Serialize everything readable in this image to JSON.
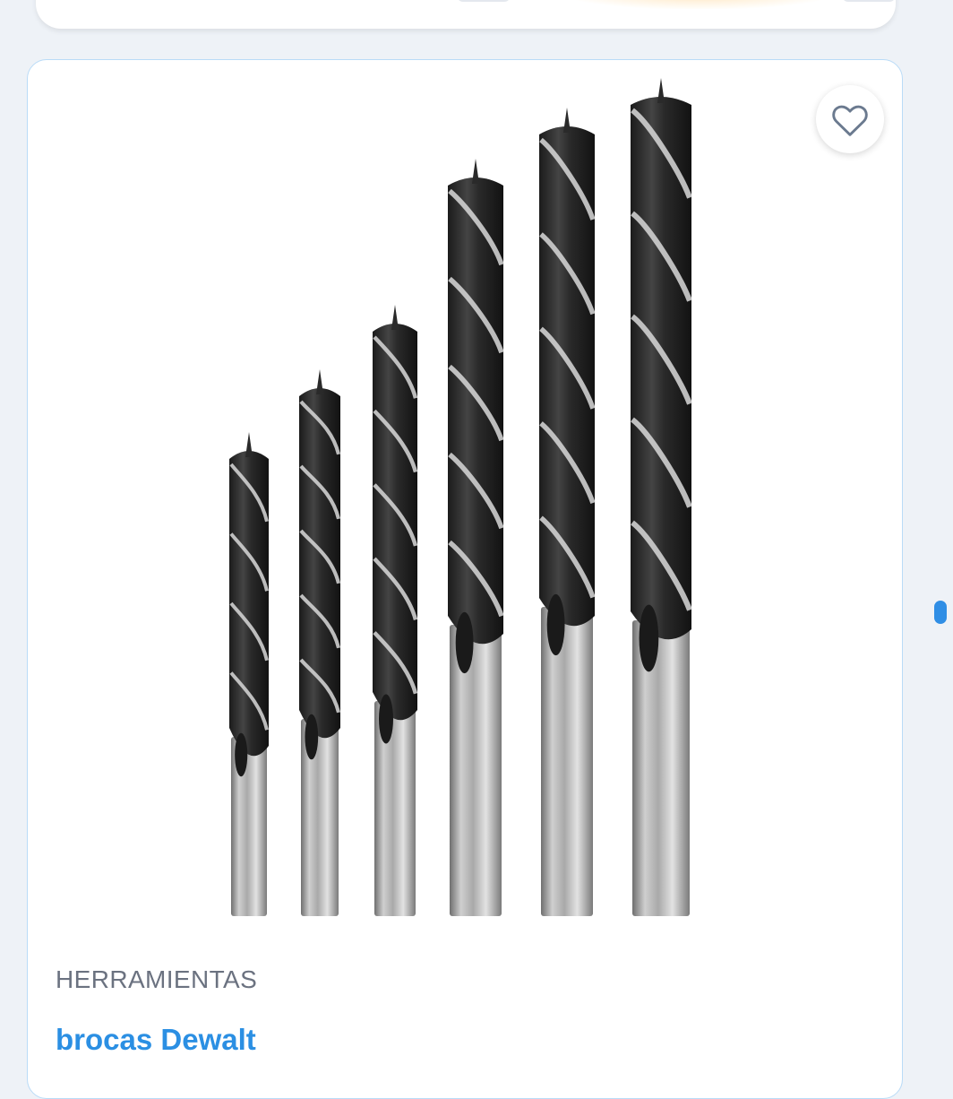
{
  "product": {
    "category": "HERRAMIENTAS",
    "title": "brocas Dewalt",
    "image_icon": "drill-bits-image",
    "favorite_icon": "heart-outline-icon"
  },
  "colors": {
    "background": "#eef2f7",
    "card_border": "#b9dbf7",
    "title": "#2b8fe3",
    "category": "#6b7280",
    "scroll_indicator": "#2f8ee5"
  }
}
